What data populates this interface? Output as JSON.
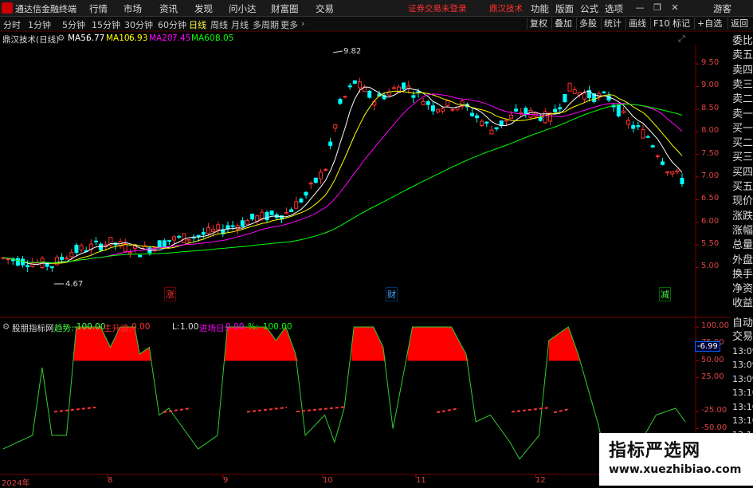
{
  "app": {
    "title": "通达信金融终端"
  },
  "menu": {
    "items": [
      "行情",
      "市场",
      "资讯",
      "发现",
      "问小达",
      "财富圈",
      "交易"
    ],
    "notice": "证券交易未登录",
    "brand": "鼎汉技术",
    "right_items": [
      "功能",
      "版面",
      "公式",
      "选项"
    ],
    "guest": "游客"
  },
  "timeframes": [
    "分时",
    "1分钟",
    "5分钟",
    "15分钟",
    "30分钟",
    "60分钟",
    "日线",
    "周线",
    "月线",
    "多周期",
    "更多"
  ],
  "active_timeframe": "日线",
  "toolbar_right": [
    "复权",
    "叠加",
    "多股",
    "统计",
    "画线",
    "F10",
    "标记",
    "+自选",
    "返回"
  ],
  "stock": {
    "name": "鼎汉技术(日线)"
  },
  "ma": {
    "ma5": {
      "label": "MA5:",
      "value": "6.77",
      "color": "#ffffff"
    },
    "ma10": {
      "label": "MA10:",
      "value": "6.93",
      "color": "#ffff00"
    },
    "ma20": {
      "label": "MA20:",
      "value": "7.45",
      "color": "#ff00ff"
    },
    "ma60": {
      "label": "MA60:",
      "value": "8.05",
      "color": "#00ff00"
    }
  },
  "price_axis": [
    "9.50",
    "9.00",
    "8.50",
    "8.00",
    "7.50",
    "7.00",
    "6.50",
    "6.00",
    "5.50",
    "5.00"
  ],
  "price_marks": {
    "high": "9.82",
    "low": "4.67"
  },
  "event_markers": {
    "zhang": "涨",
    "cai": "财",
    "jian": "减"
  },
  "right_panel": [
    "委比",
    "卖五",
    "卖四",
    "卖三",
    "卖二",
    "卖一",
    "买一",
    "买二",
    "买三",
    "买四",
    "买五",
    "现价",
    "涨跌",
    "涨幅",
    "总量",
    "外盘",
    "换手",
    "净资",
    "收益",
    "自动",
    "交易",
    "13:09",
    "13:09",
    "13:09",
    "13:10",
    "13:10",
    "13:10",
    "13:10"
  ],
  "indicator": {
    "name": "股朋指标网",
    "trend": {
      "label": "趋势:",
      "value": "-100.00"
    },
    "main_rise": {
      "label": "主升浪:",
      "value": "0.00"
    },
    "L": {
      "label": "L:",
      "value": "1.00"
    },
    "entry": {
      "label": "进场日:",
      "value": "0.00"
    },
    "pct": {
      "label": "%:",
      "value": "-100.00"
    },
    "axis": [
      "100.00",
      "75.00",
      "50.00",
      "25.00",
      "-25.00",
      "-50.00",
      "-75.00"
    ],
    "cursor_value": "-6.99"
  },
  "x_axis": [
    "2024年",
    "8",
    "9",
    "10",
    "11",
    "12"
  ],
  "watermark": {
    "line1": "指标严选网",
    "line2": "www.xuezhibiao.com"
  },
  "colors": {
    "up": "#ff3030",
    "down": "#00ffff",
    "ma5": "#ffffff",
    "ma10": "#ffff00",
    "ma20": "#ff00ff",
    "ma60": "#00ff00",
    "fill": "#ff0000"
  }
}
